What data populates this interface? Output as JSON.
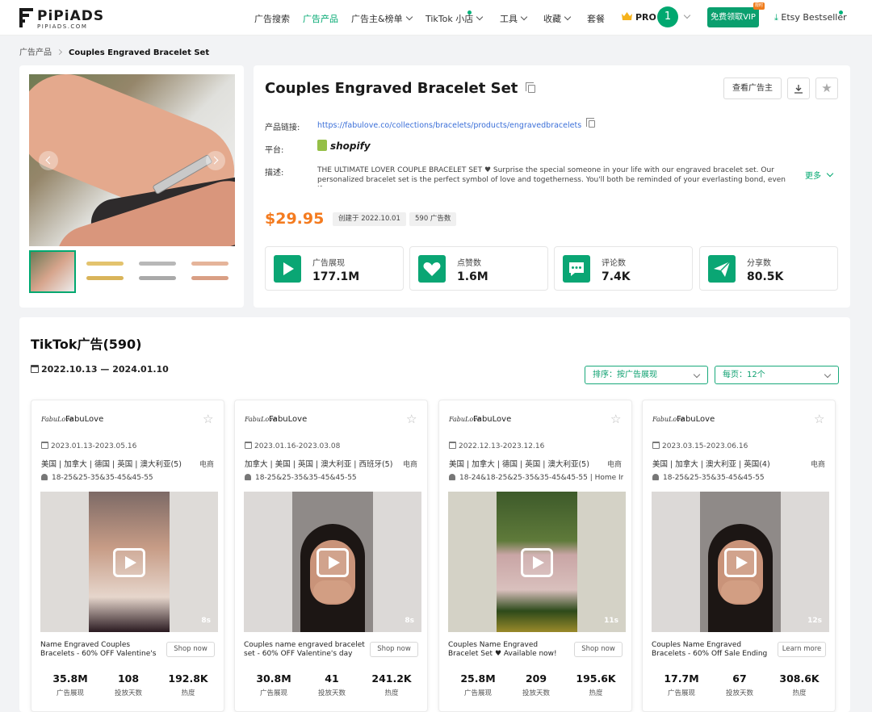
{
  "nav": {
    "logo_text": "PiPiADS",
    "logo_sub": "PIPIADS.COM",
    "items": [
      "广告搜索",
      "广告产品",
      "广告主&榜单",
      "TikTok 小店",
      "工具",
      "收藏",
      "套餐"
    ],
    "pro_label": "PRO",
    "avatar_label": "1",
    "vip_button": "免费领取VIP",
    "vip_tag": "限时",
    "etsy_label": "Etsy Bestseller"
  },
  "breadcrumb": {
    "parent": "广告产品",
    "current": "Couples Engraved Bracelet Set"
  },
  "product": {
    "title": "Couples Engraved Bracelet Set",
    "view_advertiser": "查看广告主",
    "link_label": "产品链接:",
    "link": "https://fabulove.co/collections/bracelets/products/engravedbracelets",
    "platform_label": "平台:",
    "platform": "shopify",
    "desc_label": "描述:",
    "description": "THE ULTIMATE LOVER COUPLE BRACELET SET ♥ Surprise the special someone in your life with our engraved bracelet set. Our personalized bracelet set is the perfect symbol of love and togetherness. You'll both be reminded of your everlasting bond, even if...",
    "more": "更多",
    "price": "$29.95",
    "created": "创建于 2022.10.01",
    "ad_count": "590 广告数",
    "stats": [
      {
        "name": "广告展现",
        "value": "177.1M"
      },
      {
        "name": "点赞数",
        "value": "1.6M"
      },
      {
        "name": "评论数",
        "value": "7.4K"
      },
      {
        "name": "分享数",
        "value": "80.5K"
      }
    ]
  },
  "ads_section": {
    "title": "TikTok广告(590)",
    "date_range": "2022.10.13 — 2024.01.10",
    "sort": "排序：按广告展现",
    "per_page": "每页：12个",
    "colors": {
      "accent": "#00a870",
      "price": "#f47b1f"
    }
  },
  "cards": [
    {
      "logo": "FabuLove",
      "brand": "FabuLove",
      "date": "2023.01.13-2023.05.16",
      "regions": "美国 | 加拿大 | 德国 | 英国 | 澳大利亚(5)",
      "category": "电商",
      "age": "18-25&25-35&35-45&45-55",
      "duration": "8s",
      "caption": "Name Engraved Couples Bracelets - 60% OFF Valentine's day Sale",
      "caption_heart": "♥",
      "button": "Shop now",
      "impressions": "35.8M",
      "days": "108",
      "heat": "192.8K"
    },
    {
      "logo": "FabuLove",
      "brand": "FabuLove",
      "date": "2023.01.16-2023.03.08",
      "regions": "加拿大 | 美国 | 英国 | 澳大利亚 | 西班牙(5)",
      "category": "电商",
      "age": "18-25&25-35&35-45&45-55",
      "duration": "8s",
      "caption": "Couples name engraved bracelet set - 60% OFF Valentine's day Sal...",
      "caption_heart": "",
      "button": "Shop now",
      "impressions": "30.8M",
      "days": "41",
      "heat": "241.2K"
    },
    {
      "logo": "FabuLove",
      "brand": "FabuLove",
      "date": "2022.12.13-2023.12.16",
      "regions": "美国 | 加拿大 | 德国 | 英国 | 澳大利亚(5)",
      "category": "电商",
      "age": "18-24&18-25&25-35&35-45&45-55 | Home Im...",
      "duration": "11s",
      "caption": "Couples Name Engraved Bracelet Set ♥ Available now! #couples...",
      "caption_heart": "",
      "button": "Shop now",
      "impressions": "25.8M",
      "days": "209",
      "heat": "195.6K"
    },
    {
      "logo": "FabuLove",
      "brand": "FabuLove",
      "date": "2023.03.15-2023.06.16",
      "regions": "美国 | 加拿大 | 澳大利亚 | 英国(4)",
      "category": "电商",
      "age": "18-25&25-35&35-45&45-55",
      "duration": "12s",
      "caption": "Couples Name Engraved Bracelets - 60% Off Sale Ending ...",
      "caption_heart": "",
      "button": "Learn more",
      "impressions": "17.7M",
      "days": "67",
      "heat": "308.6K"
    }
  ],
  "metric_labels": {
    "impressions": "广告展现",
    "days": "投放天数",
    "heat": "热度"
  }
}
